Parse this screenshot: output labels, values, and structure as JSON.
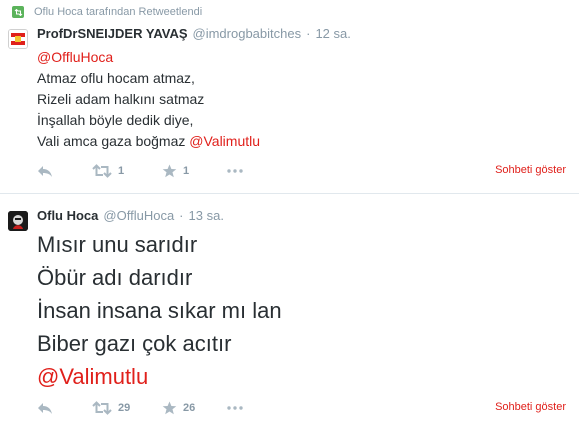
{
  "retweet_context": {
    "text": "Oflu Hoca tarafından Retweetlendi",
    "icon": "retweet-badge-icon"
  },
  "colors": {
    "accent": "#e0201b",
    "muted": "#8899a6",
    "icon": "#aab8c2",
    "text": "#292f33",
    "retweet": "#5bb35b"
  },
  "tweets": [
    {
      "fullname": "ProfDrSNEIJDER YAVAŞ",
      "username": "@imdrogbabitches",
      "separator": "·",
      "time": "12 sa.",
      "lines": [
        {
          "mention": "@OffluHoca"
        },
        {
          "text": "Atmaz oflu hocam atmaz,"
        },
        {
          "text": "Rizeli adam halkını satmaz"
        },
        {
          "text": "İnşallah böyle dedik diye,"
        },
        {
          "text": "Vali amca gaza boğmaz ",
          "mention": "@Valimutlu"
        }
      ],
      "retweet_count": "1",
      "favorite_count": "1",
      "expand_label": "Sohbeti göster"
    },
    {
      "fullname": "Oflu Hoca",
      "username": "@OffluHoca",
      "separator": "·",
      "time": "13 sa.",
      "lines": [
        {
          "text": "Mısır unu sarıdır"
        },
        {
          "text": "Öbür adı darıdır"
        },
        {
          "text": "İnsan insana sıkar mı lan"
        },
        {
          "text": "Biber gazı çok acıtır"
        },
        {
          "mention": "@Valimutlu"
        }
      ],
      "retweet_count": "29",
      "favorite_count": "26",
      "expand_label": "Sohbeti göster"
    }
  ]
}
